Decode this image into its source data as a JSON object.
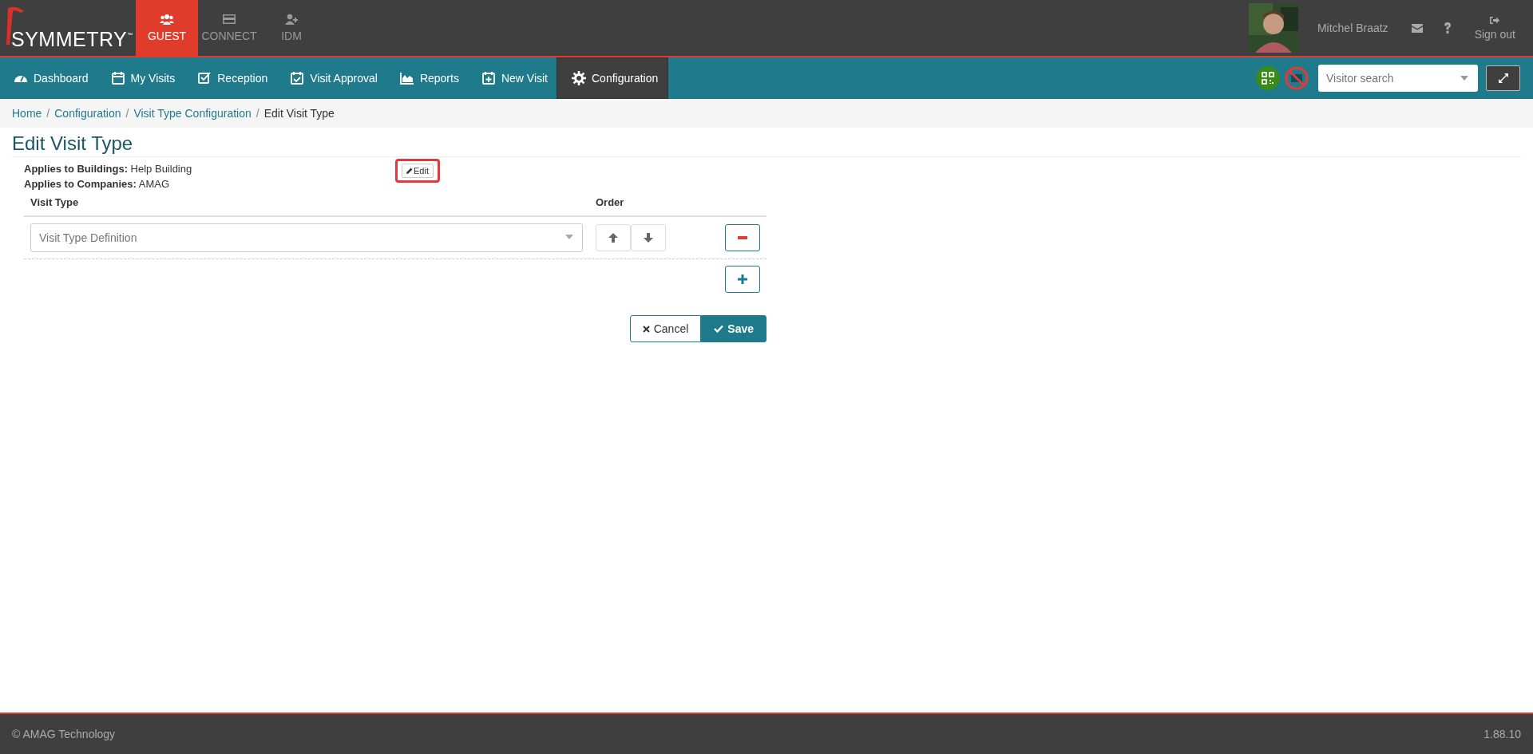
{
  "brand": {
    "logo": "SYMMETRY",
    "trademark": "™"
  },
  "apps": [
    {
      "label": "GUEST",
      "selected": true
    },
    {
      "label": "CONNECT",
      "selected": false
    },
    {
      "label": "IDM",
      "selected": false
    }
  ],
  "user": {
    "name": "Mitchel Braatz",
    "sign_out": "Sign out"
  },
  "nav": [
    {
      "label": "Dashboard",
      "selected": false
    },
    {
      "label": "My Visits",
      "selected": false
    },
    {
      "label": "Reception",
      "selected": false
    },
    {
      "label": "Visit Approval",
      "selected": false
    },
    {
      "label": "Reports",
      "selected": false
    },
    {
      "label": "New Visit",
      "selected": false
    },
    {
      "label": "Configuration",
      "selected": true
    }
  ],
  "visitor_search": {
    "placeholder": "Visitor search"
  },
  "breadcrumb": [
    {
      "label": "Home",
      "current": false
    },
    {
      "separator": "/",
      "label": "Configuration",
      "current": false
    },
    {
      "separator": "/",
      "label": "Visit Type Configuration",
      "current": false
    },
    {
      "separator": "/",
      "label": "Edit Visit Type",
      "current": true
    }
  ],
  "page_title": "Edit Visit Type",
  "applies": [
    {
      "label": "Applies to Buildings:",
      "value": "Help Building"
    },
    {
      "label": "Applies to Companies:",
      "value": "AMAG"
    }
  ],
  "edit_button": {
    "label": "Edit",
    "highlighted": true
  },
  "table": {
    "columns": [
      "Visit Type",
      "Order"
    ],
    "rows": [
      {
        "placeholder": "Visit Type Definition"
      }
    ]
  },
  "cancel": "Cancel",
  "save": "Save",
  "footer": {
    "copyright": "© AMAG Technology",
    "version": "1.88.10"
  }
}
